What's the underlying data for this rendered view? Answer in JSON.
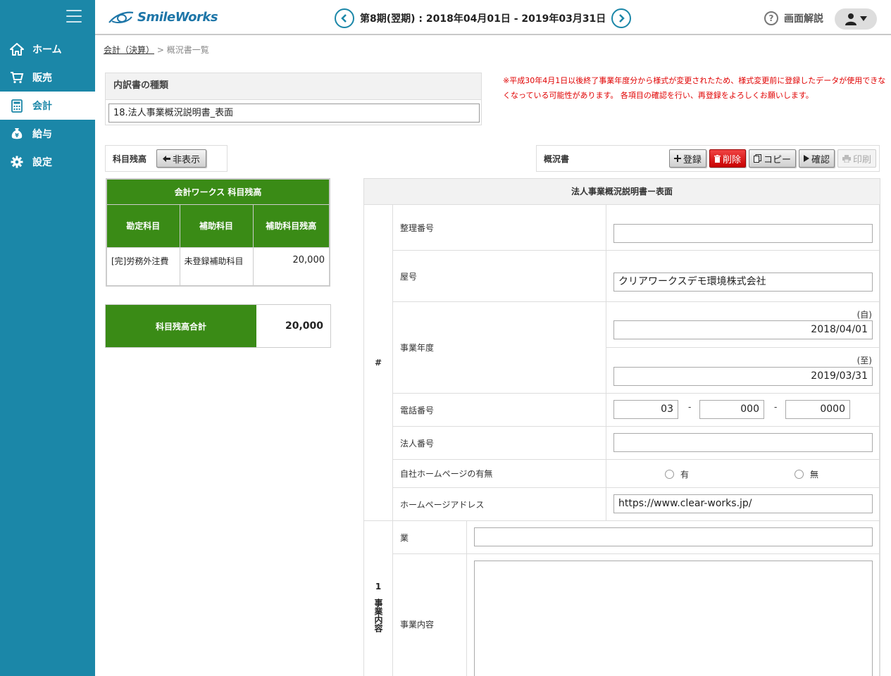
{
  "app": {
    "logo_text": "SmileWorks",
    "period": "第8期(翌期) : 2018年04月01日 - 2019年03月31日",
    "help_label": "画面解説"
  },
  "sidebar": {
    "items": [
      {
        "label": "ホーム",
        "icon": "home-icon"
      },
      {
        "label": "販売",
        "icon": "cart-icon"
      },
      {
        "label": "会計",
        "icon": "calculator-icon",
        "active": true
      },
      {
        "label": "給与",
        "icon": "money-bag-icon"
      },
      {
        "label": "設定",
        "icon": "gear-icon"
      }
    ]
  },
  "breadcrumb": {
    "parent": "会計（決算）",
    "separator": ">",
    "current": "概況書一覧"
  },
  "type_panel": {
    "label": "内訳書の種類",
    "selected": "18.法人事業概況説明書_表面"
  },
  "notice": "※平成30年4月1日以後終了事業年度分から様式が変更されたため、様式変更前に登録したデータが使用できなくなっている可能性があります。 各項目の確認を行い、再登録をよろしくお願いします。",
  "balance": {
    "label": "科目残高",
    "hide_button": "非表示",
    "table_title": "会計ワークス 科目残高",
    "headers": [
      "勘定科目",
      "補助科目",
      "補助科目残高"
    ],
    "rows": [
      {
        "account": "[完]労務外注費",
        "sub": "未登録補助科目",
        "amount": "20,000"
      }
    ],
    "total_label": "科目残高合計",
    "total_value": "20,000"
  },
  "summary": {
    "label": "概況書",
    "buttons": {
      "register": "登録",
      "delete": "削除",
      "copy": "コピー",
      "confirm": "確認",
      "print": "印刷"
    },
    "colors": {
      "delete": "#d40000"
    }
  },
  "form": {
    "title": "法人事業概況説明書ー表面",
    "section_hash": "#",
    "fields": {
      "seiri_label": "整理番号",
      "seiri_value": "",
      "yago_label": "屋号",
      "yago_value": "クリアワークスデモ環境株式会社",
      "nendo_label": "事業年度",
      "from_label": "(自)",
      "from_value": "2018/04/01",
      "to_label": "(至)",
      "to_value": "2019/03/31",
      "tel_label": "電話番号",
      "tel1": "03",
      "tel2": "000",
      "tel3": "0000",
      "tel_sep": "-",
      "houjin_label": "法人番号",
      "houjin_value": "",
      "hp_exists_label": "自社ホームページの有無",
      "hp_yes": "有",
      "hp_no": "無",
      "hp_url_label": "ホームページアドレス",
      "hp_url_value": "https://www.clear-works.jp/"
    },
    "section1": {
      "num": "1",
      "title": "事業内容",
      "gyo_label": "業",
      "gyo_value": "",
      "content_label": "事業内容",
      "content_value": ""
    }
  },
  "colors": {
    "sidebar": "#1b87a8",
    "green": "#3a8b16",
    "notice": "#e00000"
  }
}
